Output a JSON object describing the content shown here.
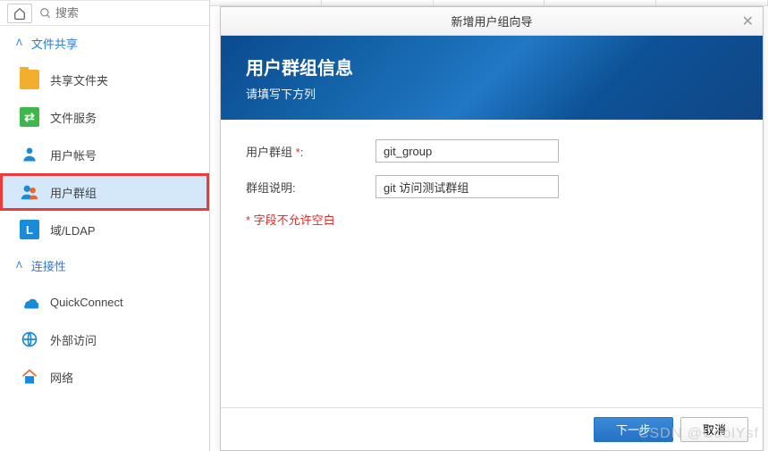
{
  "search": {
    "placeholder": "搜索"
  },
  "sections": {
    "fileshare": {
      "label": "文件共享"
    },
    "connectivity": {
      "label": "连接性"
    }
  },
  "sidebar": {
    "shared_folder": "共享文件夹",
    "file_services": "文件服务",
    "user_account": "用户帐号",
    "user_group": "用户群组",
    "domain_ldap": "域/LDAP",
    "quickconnect": "QuickConnect",
    "external_access": "外部访问",
    "network": "网络"
  },
  "dialog": {
    "title": "新增用户组向导",
    "banner_title": "用户群组信息",
    "banner_subtitle": "请填写下方列",
    "field_group_label": "用户群组",
    "field_group_value": "git_group",
    "field_desc_label": "群组说明:",
    "field_desc_value": "git 访问测试群组",
    "required_note": "* 字段不允许空白",
    "btn_next": "下一步",
    "btn_cancel": "取消"
  },
  "watermark": "CSDN @CoolYsf"
}
